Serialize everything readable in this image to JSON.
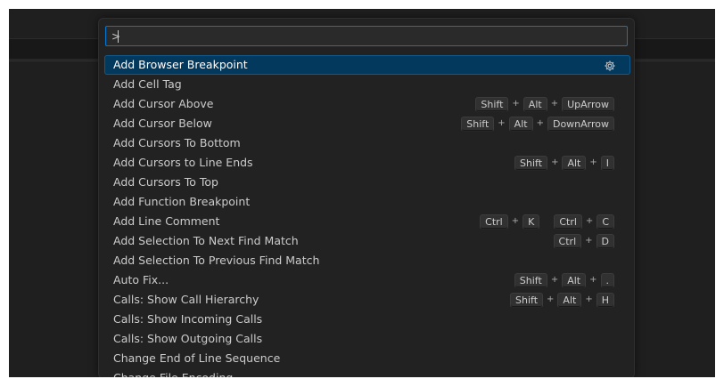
{
  "palette": {
    "input_value": ">",
    "items": [
      {
        "label": "Add Browser Breakpoint",
        "selected": true,
        "gear": true,
        "chords": []
      },
      {
        "label": "Add Cell Tag",
        "chords": []
      },
      {
        "label": "Add Cursor Above",
        "chords": [
          [
            "Shift",
            "Alt",
            "UpArrow"
          ]
        ]
      },
      {
        "label": "Add Cursor Below",
        "chords": [
          [
            "Shift",
            "Alt",
            "DownArrow"
          ]
        ]
      },
      {
        "label": "Add Cursors To Bottom",
        "chords": []
      },
      {
        "label": "Add Cursors to Line Ends",
        "chords": [
          [
            "Shift",
            "Alt",
            "I"
          ]
        ]
      },
      {
        "label": "Add Cursors To Top",
        "chords": []
      },
      {
        "label": "Add Function Breakpoint",
        "chords": []
      },
      {
        "label": "Add Line Comment",
        "chords": [
          [
            "Ctrl",
            "K"
          ],
          [
            "Ctrl",
            "C"
          ]
        ]
      },
      {
        "label": "Add Selection To Next Find Match",
        "chords": [
          [
            "Ctrl",
            "D"
          ]
        ]
      },
      {
        "label": "Add Selection To Previous Find Match",
        "chords": []
      },
      {
        "label": "Auto Fix...",
        "chords": [
          [
            "Shift",
            "Alt",
            "."
          ]
        ]
      },
      {
        "label": "Calls: Show Call Hierarchy",
        "chords": [
          [
            "Shift",
            "Alt",
            "H"
          ]
        ]
      },
      {
        "label": "Calls: Show Incoming Calls",
        "chords": []
      },
      {
        "label": "Calls: Show Outgoing Calls",
        "chords": []
      },
      {
        "label": "Change End of Line Sequence",
        "chords": []
      },
      {
        "label": "Change File Encoding",
        "chords": []
      }
    ]
  },
  "icons": {
    "gear": "gear-icon"
  },
  "colors": {
    "accent": "#0078d4",
    "selected_bg": "#04395e",
    "panel_bg": "#222222",
    "window_bg": "#1f1f1f"
  }
}
